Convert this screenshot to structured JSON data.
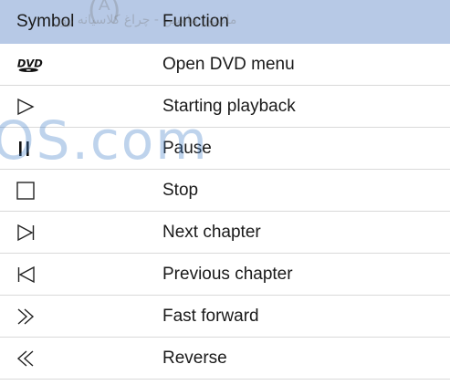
{
  "table": {
    "headers": {
      "symbol": "Symbol",
      "function": "Function"
    },
    "rows": [
      {
        "icon": "dvd-logo-icon",
        "label": "Open DVD menu"
      },
      {
        "icon": "play-icon",
        "label": "Starting playback"
      },
      {
        "icon": "pause-icon",
        "label": "Pause"
      },
      {
        "icon": "stop-icon",
        "label": "Stop"
      },
      {
        "icon": "next-chapter-icon",
        "label": "Next chapter"
      },
      {
        "icon": "previous-chapter-icon",
        "label": "Previous chapter"
      },
      {
        "icon": "fast-forward-icon",
        "label": "Fast forward"
      },
      {
        "icon": "reverse-icon",
        "label": "Reverse"
      }
    ]
  },
  "watermark": {
    "latin": "OS.com",
    "arabic": "مانیتور ماشین - چراغ کلاسیانه روز",
    "ring": "(ᴬ)"
  },
  "colors": {
    "header_bg": "#b7c9e6",
    "row_border": "#d9d9d9",
    "watermark_blue": "#4682c8"
  }
}
